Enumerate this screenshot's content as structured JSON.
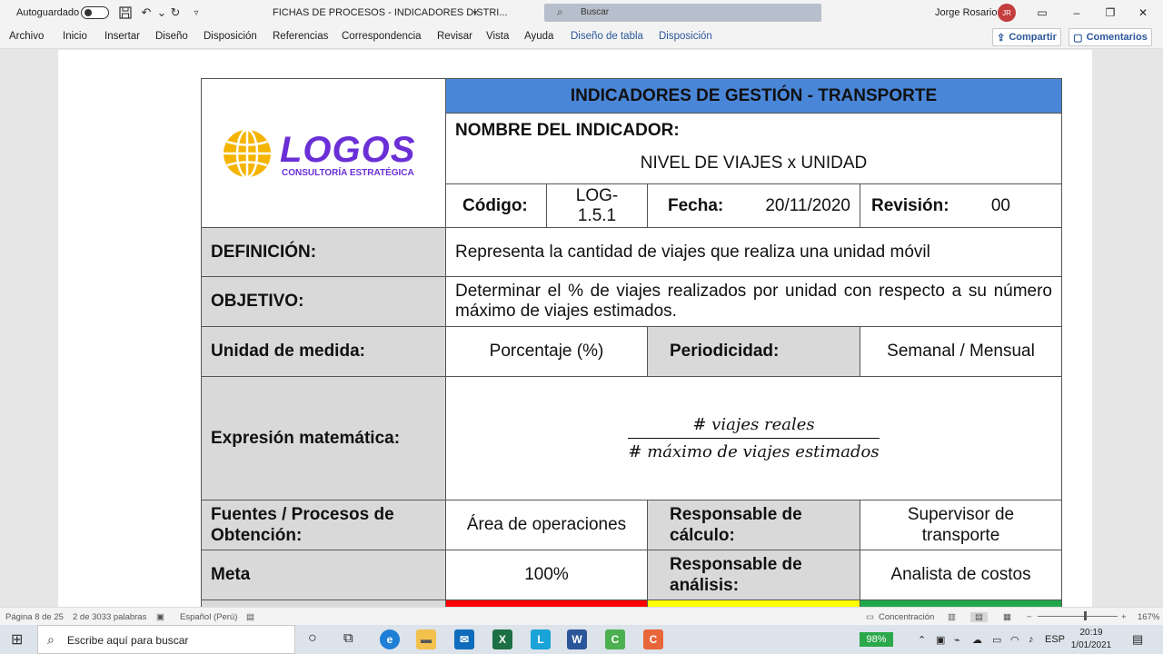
{
  "titlebar": {
    "autosave_label": "Autoguardado",
    "document_title": "FICHAS DE PROCESOS - INDICADORES DISTRI...",
    "search_placeholder": "Buscar",
    "user_name": "Jorge Rosario",
    "user_initials": "JR"
  },
  "ribbon": {
    "tabs": [
      "Archivo",
      "Inicio",
      "Insertar",
      "Diseño",
      "Disposición",
      "Referencias",
      "Correspondencia",
      "Revisar",
      "Vista",
      "Ayuda"
    ],
    "context_tabs": [
      "Diseño de tabla",
      "Disposición"
    ],
    "share_label": "Compartir",
    "comments_label": "Comentarios"
  },
  "logo": {
    "name": "LOGOS",
    "tagline": "CONSULTORÍA ESTRATÉGICA"
  },
  "ficha": {
    "header": "INDICADORES DE GESTIÓN - TRANSPORTE",
    "nombre_label": "NOMBRE DEL INDICADOR:",
    "nombre_value": "NIVEL DE VIAJES x UNIDAD",
    "codigo_label": "Código:",
    "codigo_value": "LOG-1.5.1",
    "fecha_label": "Fecha:",
    "fecha_value": "20/11/2020",
    "revision_label": "Revisión:",
    "revision_value": "00",
    "definicion_label": "DEFINICIÓN:",
    "definicion_value": "Representa la cantidad de viajes que realiza una unidad móvil",
    "objetivo_label": "OBJETIVO:",
    "objetivo_value": "Determinar el % de viajes realizados por unidad con respecto a su número máximo de viajes estimados.",
    "unidad_label": "Unidad de medida:",
    "unidad_value": "Porcentaje (%)",
    "periodicidad_label": "Periodicidad:",
    "periodicidad_value": "Semanal / Mensual",
    "expresion_label": "Expresión matemática:",
    "expresion_numerador": "# viajes reales",
    "expresion_denominador": "# máximo de viajes estimados",
    "fuentes_label": "Fuentes / Procesos de Obtención:",
    "fuentes_value": "Área de operaciones",
    "resp_calculo_label": "Responsable de cálculo:",
    "resp_calculo_value": "Supervisor de transporte",
    "meta_label": "Meta",
    "meta_value": "100%",
    "resp_analisis_label": "Responsable de análisis:",
    "resp_analisis_value": "Analista de costos",
    "semaforo_colors": [
      "#ff0000",
      "#ffff00",
      "#1fa84a"
    ]
  },
  "statusbar": {
    "page": "Página 8 de 25",
    "words": "2 de 3033 palabras",
    "language": "Español (Perú)",
    "focus": "Concentración",
    "zoom": "167%"
  },
  "taskbar": {
    "search_placeholder": "Escribe aquí para buscar",
    "battery": "98%",
    "lang": "ESP",
    "time": "20:19",
    "date": "1/01/2021"
  }
}
